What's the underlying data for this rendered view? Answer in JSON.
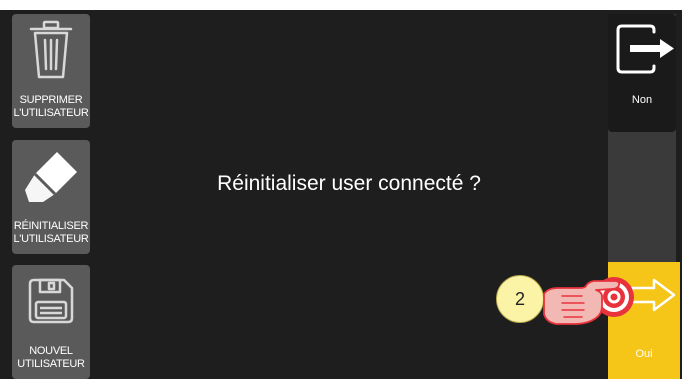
{
  "sidebar": {
    "buttons": [
      {
        "line1": "SUPPRIMER",
        "line2": "L'UTILISATEUR",
        "icon": "trash-icon"
      },
      {
        "line1": "RÉINITIALISER",
        "line2": "L'UTILISATEUR",
        "icon": "eraser-icon"
      },
      {
        "line1": "NOUVEL",
        "line2": "UTILISATEUR",
        "icon": "save-icon"
      }
    ]
  },
  "dialog": {
    "message": "Réinitialiser user connecté ?"
  },
  "actions": {
    "no_label": "Non",
    "no_icon": "exit-arrow-icon",
    "yes_label": "Oui",
    "yes_icon": "arrow-right-icon"
  },
  "annotation": {
    "step_number": "2",
    "icon": "touch-hand-icon"
  },
  "colors": {
    "background": "#1e1e1e",
    "button": "#5a5a5a",
    "confirm": "#f5c518",
    "touch": "#e8323c"
  }
}
